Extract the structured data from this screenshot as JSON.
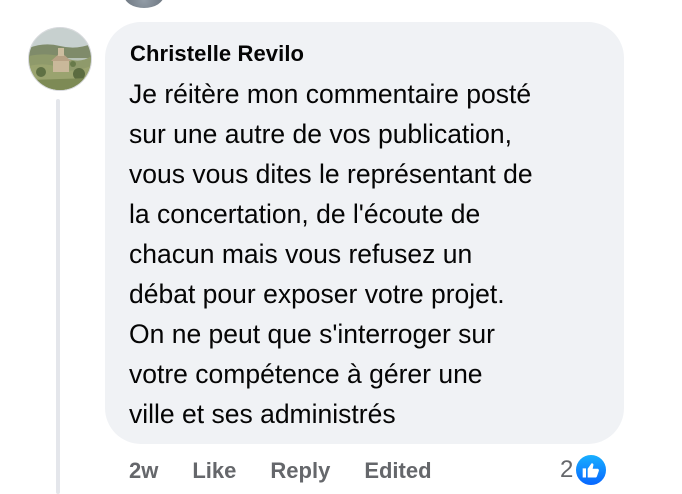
{
  "comment": {
    "author": "Christelle Revilo",
    "text": "Je réitère mon commentaire posté\nsur une autre de vos publication,\nvous vous dites le représentant de\nla concertation, de l'écoute de\nchacun mais vous refusez un\ndébat pour exposer votre projet.\nOn ne peut que s'interroger sur\nvotre compétence à gérer une\nville et ses administrés",
    "avatar_icon": "profile-photo-landscape"
  },
  "actions": {
    "time": "2w",
    "like_label": "Like",
    "reply_label": "Reply",
    "edited_label": "Edited"
  },
  "reactions": {
    "count": "2",
    "icon": "thumbs-up-icon",
    "color": "#0866ff"
  },
  "colors": {
    "bubble": "#f0f2f5",
    "text": "#050505",
    "secondary": "#65676b",
    "thread_line": "#e4e6eb"
  }
}
